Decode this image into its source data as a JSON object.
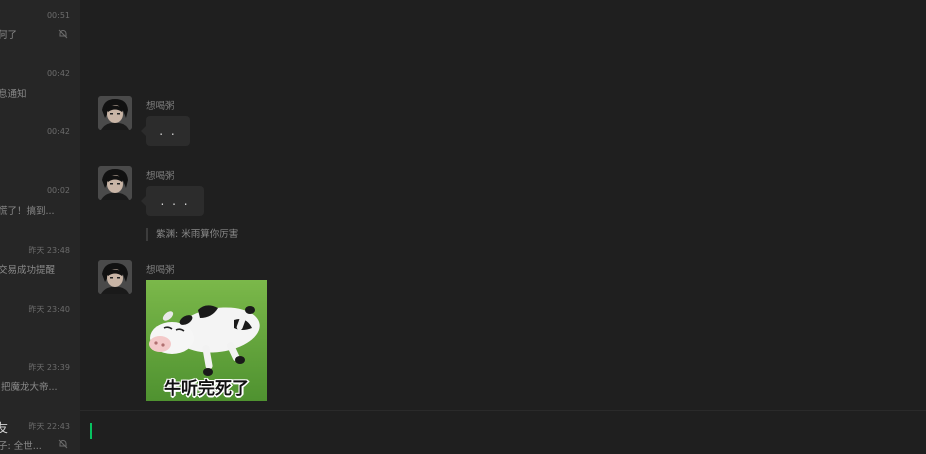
{
  "sidebar": {
    "conversations": [
      {
        "time": "00:51",
        "preview": "何了",
        "muted": true
      },
      {
        "time": "00:42",
        "preview": "息通知",
        "muted": false
      },
      {
        "time": "00:42",
        "preview": "",
        "muted": false
      },
      {
        "time": "00:02",
        "preview": "慌了！搞到...",
        "muted": false
      },
      {
        "time": "昨天 23:48",
        "preview": "交易成功提醒",
        "muted": false
      },
      {
        "time": "昨天 23:40",
        "preview": "",
        "muted": false
      },
      {
        "time": "昨天 23:39",
        "preview": "·把魔龙大帝...",
        "muted": false
      },
      {
        "time": "昨天 22:43",
        "name": "友",
        "preview": "子: 全世...",
        "muted": true
      }
    ]
  },
  "chat": {
    "messages": [
      {
        "sender": "想喝粥",
        "text": ". ."
      },
      {
        "sender": "想喝粥",
        "text": ". . .",
        "quote": "紫渊: 米雨算你厉害"
      },
      {
        "sender": "想喝粥",
        "sticker_caption": "牛听完死了"
      }
    ]
  },
  "input": {
    "value": ""
  },
  "colors": {
    "accent": "#07c160",
    "background": "#1f1f1f",
    "sidebar": "#262626",
    "bubble": "#2c2c2c"
  },
  "icons": {
    "mute": "bell-slash-icon",
    "avatar": "avatar-icon"
  }
}
